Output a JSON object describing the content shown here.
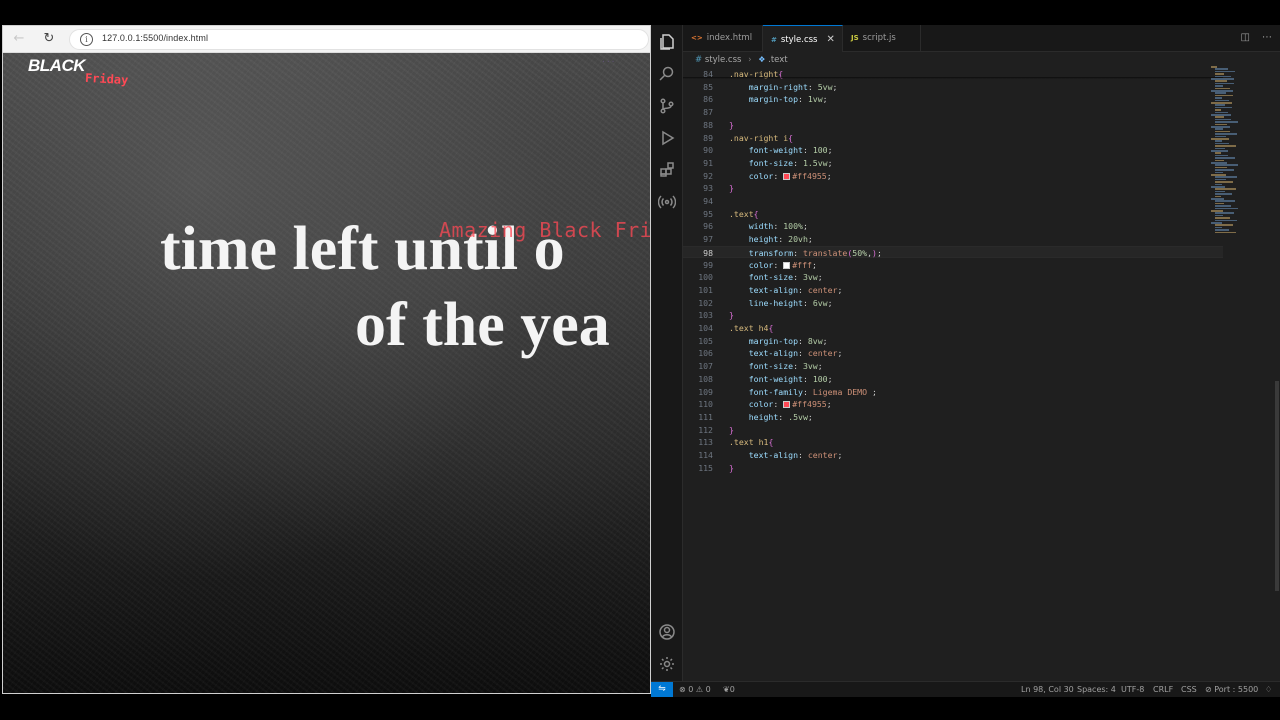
{
  "browser": {
    "url": "127.0.0.1:5500/index.html",
    "logo_top": "BLACK",
    "logo_bottom": "Friday",
    "nav_ghost": "...",
    "headline_line1": "time left until o",
    "headline_line2": "of the yea",
    "overlay_text": "Amazing Black Friday",
    "accent_color": "#ff4955"
  },
  "vscode": {
    "tabs": [
      {
        "icon": "<>",
        "label": "index.html"
      },
      {
        "icon": "#",
        "label": "style.css",
        "active": true
      },
      {
        "icon": "JS",
        "label": "script.js"
      }
    ],
    "breadcrumb": {
      "file": "style.css",
      "symbol": ".text"
    },
    "lines": [
      {
        "n": "84",
        "parts": [
          [
            "sel",
            ".nav-right"
          ],
          [
            "brace",
            "{"
          ]
        ]
      },
      {
        "n": "85",
        "parts": [
          [
            "indent",
            "    "
          ],
          [
            "prop",
            "margin-right"
          ],
          [
            "punc",
            ": "
          ],
          [
            "num",
            "5vw"
          ],
          [
            "punc",
            ";"
          ]
        ]
      },
      {
        "n": "86",
        "parts": [
          [
            "indent",
            "    "
          ],
          [
            "prop",
            "margin-top"
          ],
          [
            "punc",
            ": "
          ],
          [
            "num",
            "1vw"
          ],
          [
            "punc",
            ";"
          ]
        ]
      },
      {
        "n": "87",
        "parts": []
      },
      {
        "n": "88",
        "parts": [
          [
            "brace",
            "}"
          ]
        ]
      },
      {
        "n": "89",
        "parts": [
          [
            "sel",
            ".nav-right i"
          ],
          [
            "brace",
            "{"
          ]
        ]
      },
      {
        "n": "90",
        "parts": [
          [
            "indent",
            "    "
          ],
          [
            "prop",
            "font-weight"
          ],
          [
            "punc",
            ": "
          ],
          [
            "num",
            "100"
          ],
          [
            "punc",
            ";"
          ]
        ]
      },
      {
        "n": "91",
        "parts": [
          [
            "indent",
            "    "
          ],
          [
            "prop",
            "font-size"
          ],
          [
            "punc",
            ": "
          ],
          [
            "num",
            "1.5vw"
          ],
          [
            "punc",
            ";"
          ]
        ]
      },
      {
        "n": "92",
        "parts": [
          [
            "indent",
            "    "
          ],
          [
            "prop",
            "color"
          ],
          [
            "punc",
            ": "
          ],
          [
            "swatch",
            "#ff4955"
          ],
          [
            "val",
            "#ff4955"
          ],
          [
            "punc",
            ";"
          ]
        ]
      },
      {
        "n": "93",
        "parts": [
          [
            "brace",
            "}"
          ]
        ]
      },
      {
        "n": "94",
        "parts": []
      },
      {
        "n": "95",
        "parts": [
          [
            "sel",
            ".text"
          ],
          [
            "brace",
            "{"
          ]
        ]
      },
      {
        "n": "96",
        "parts": [
          [
            "indent",
            "    "
          ],
          [
            "prop",
            "width"
          ],
          [
            "punc",
            ": "
          ],
          [
            "num",
            "100%"
          ],
          [
            "punc",
            ";"
          ]
        ]
      },
      {
        "n": "97",
        "parts": [
          [
            "indent",
            "    "
          ],
          [
            "prop",
            "height"
          ],
          [
            "punc",
            ": "
          ],
          [
            "num",
            "20vh"
          ],
          [
            "punc",
            ";"
          ]
        ]
      },
      {
        "n": "98",
        "current": true,
        "parts": [
          [
            "indent",
            "    "
          ],
          [
            "prop",
            "transform"
          ],
          [
            "punc",
            ": "
          ],
          [
            "val",
            "translate"
          ],
          [
            "brace",
            "("
          ],
          [
            "num",
            "50%"
          ],
          [
            "punc",
            ","
          ],
          [
            "brace",
            ")"
          ],
          [
            "punc",
            ";"
          ]
        ]
      },
      {
        "n": "99",
        "parts": [
          [
            "indent",
            "    "
          ],
          [
            "prop",
            "color"
          ],
          [
            "punc",
            ": "
          ],
          [
            "swatch",
            "#ffffff"
          ],
          [
            "val",
            "#fff"
          ],
          [
            "punc",
            ";"
          ]
        ]
      },
      {
        "n": "100",
        "parts": [
          [
            "indent",
            "    "
          ],
          [
            "prop",
            "font-size"
          ],
          [
            "punc",
            ": "
          ],
          [
            "num",
            "3vw"
          ],
          [
            "punc",
            ";"
          ]
        ]
      },
      {
        "n": "101",
        "parts": [
          [
            "indent",
            "    "
          ],
          [
            "prop",
            "text-align"
          ],
          [
            "punc",
            ": "
          ],
          [
            "val",
            "center"
          ],
          [
            "punc",
            ";"
          ]
        ]
      },
      {
        "n": "102",
        "parts": [
          [
            "indent",
            "    "
          ],
          [
            "prop",
            "line-height"
          ],
          [
            "punc",
            ": "
          ],
          [
            "num",
            "6vw"
          ],
          [
            "punc",
            ";"
          ]
        ]
      },
      {
        "n": "103",
        "parts": [
          [
            "brace",
            "}"
          ]
        ]
      },
      {
        "n": "104",
        "parts": [
          [
            "sel",
            ".text h4"
          ],
          [
            "brace",
            "{"
          ]
        ]
      },
      {
        "n": "105",
        "parts": [
          [
            "indent",
            "    "
          ],
          [
            "prop",
            "margin-top"
          ],
          [
            "punc",
            ": "
          ],
          [
            "num",
            "8vw"
          ],
          [
            "punc",
            ";"
          ]
        ]
      },
      {
        "n": "106",
        "parts": [
          [
            "indent",
            "    "
          ],
          [
            "prop",
            "text-align"
          ],
          [
            "punc",
            ": "
          ],
          [
            "val",
            "center"
          ],
          [
            "punc",
            ";"
          ]
        ]
      },
      {
        "n": "107",
        "parts": [
          [
            "indent",
            "    "
          ],
          [
            "prop",
            "font-size"
          ],
          [
            "punc",
            ": "
          ],
          [
            "num",
            "3vw"
          ],
          [
            "punc",
            ";"
          ]
        ]
      },
      {
        "n": "108",
        "parts": [
          [
            "indent",
            "    "
          ],
          [
            "prop",
            "font-weight"
          ],
          [
            "punc",
            ": "
          ],
          [
            "num",
            "100"
          ],
          [
            "punc",
            ";"
          ]
        ]
      },
      {
        "n": "109",
        "parts": [
          [
            "indent",
            "    "
          ],
          [
            "prop",
            "font-family"
          ],
          [
            "punc",
            ": "
          ],
          [
            "val",
            "Ligema DEMO"
          ],
          [
            "punc",
            " ;"
          ]
        ]
      },
      {
        "n": "110",
        "parts": [
          [
            "indent",
            "    "
          ],
          [
            "prop",
            "color"
          ],
          [
            "punc",
            ": "
          ],
          [
            "swatch",
            "#ff4955"
          ],
          [
            "val",
            "#ff4955"
          ],
          [
            "punc",
            ";"
          ]
        ]
      },
      {
        "n": "111",
        "parts": [
          [
            "indent",
            "    "
          ],
          [
            "prop",
            "height"
          ],
          [
            "punc",
            ": "
          ],
          [
            "num",
            ".5vw"
          ],
          [
            "punc",
            ";"
          ]
        ]
      },
      {
        "n": "112",
        "parts": [
          [
            "brace",
            "}"
          ]
        ]
      },
      {
        "n": "113",
        "parts": [
          [
            "sel",
            ".text h1"
          ],
          [
            "brace",
            "{"
          ]
        ]
      },
      {
        "n": "114",
        "parts": [
          [
            "indent",
            "    "
          ],
          [
            "prop",
            "text-align"
          ],
          [
            "punc",
            ": "
          ],
          [
            "val",
            "center"
          ],
          [
            "punc",
            ";"
          ]
        ]
      },
      {
        "n": "115",
        "parts": [
          [
            "brace",
            "}"
          ]
        ]
      }
    ],
    "status": {
      "errors": "0",
      "warnings": "0",
      "ports": "0",
      "position": "Ln 98, Col 30",
      "spaces": "Spaces: 4",
      "encoding": "UTF-8",
      "eol": "CRLF",
      "language": "CSS",
      "port": "Port : 5500"
    }
  }
}
